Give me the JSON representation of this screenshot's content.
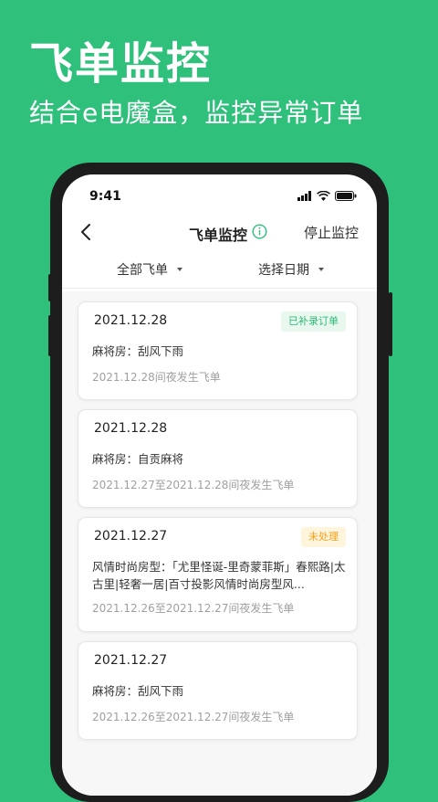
{
  "hero": {
    "title": "飞单监控",
    "subtitle": "结合e电魔盒，监控异常订单"
  },
  "status_bar": {
    "time": "9:41",
    "icons": [
      "signal-icon",
      "wifi-icon",
      "battery-icon"
    ]
  },
  "nav": {
    "back_icon": "back-arrow-icon",
    "title": "飞单监控",
    "info_icon": "info-icon",
    "action": "停止监控"
  },
  "filters": [
    {
      "label": "全部飞单"
    },
    {
      "label": "选择日期"
    }
  ],
  "orders": [
    {
      "date": "2021.12.28",
      "badge": "已补录订单",
      "badge_status": "done",
      "title": "麻将房：刮风下雨",
      "desc": "2021.12.28间夜发生飞单"
    },
    {
      "date": "2021.12.28",
      "badge": "",
      "badge_status": "",
      "title": "麻将房：自贡麻将",
      "desc": "2021.12.27至2021.12.28间夜发生飞单"
    },
    {
      "date": "2021.12.27",
      "badge": "未处理",
      "badge_status": "pending",
      "title": "风情时尚房型：「尤里怪诞-里奇蒙菲斯」春熙路|太古里|轻奢一居|百寸投影风情时尚房型风...",
      "desc": "2021.12.26至2021.12.27间夜发生飞单"
    },
    {
      "date": "2021.12.27",
      "badge": "",
      "badge_status": "",
      "title": "麻将房：刮风下雨",
      "desc": "2021.12.26至2021.12.27间夜发生飞单"
    }
  ],
  "colors": {
    "brand_green": "#2fc07c",
    "done_badge_text": "#2fb877",
    "pending_badge_text": "#f2a11e"
  }
}
